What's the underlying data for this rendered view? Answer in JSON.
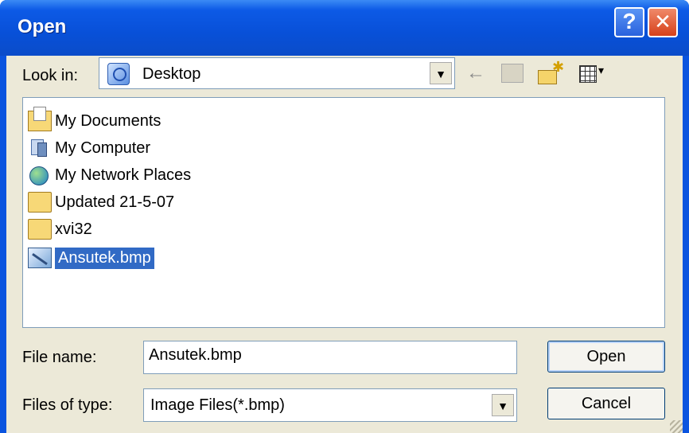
{
  "window": {
    "title": "Open"
  },
  "titlebar": {
    "help_glyph": "?",
    "close_glyph": "✕"
  },
  "look_in": {
    "label": "Look in:",
    "value": "Desktop",
    "dropdown_glyph": "▼"
  },
  "toolbar": {
    "back_glyph": "←",
    "views_arrow_glyph": "▾"
  },
  "files": [
    {
      "name": "My Documents",
      "icon": "my-documents-icon"
    },
    {
      "name": "My Computer",
      "icon": "my-computer-icon"
    },
    {
      "name": "My Network Places",
      "icon": "network-places-icon"
    },
    {
      "name": "Updated 21-5-07",
      "icon": "folder-icon"
    },
    {
      "name": "xvi32",
      "icon": "folder-icon"
    },
    {
      "name": "Ansutek.bmp",
      "icon": "bitmap-file-icon",
      "selected": true
    }
  ],
  "file_name": {
    "label": "File name:",
    "value": "Ansutek.bmp"
  },
  "file_type": {
    "label": "Files of type:",
    "value": "Image Files(*.bmp)",
    "dropdown_glyph": "▼"
  },
  "buttons": {
    "open": "Open",
    "cancel": "Cancel"
  },
  "colors": {
    "title_bar": "#0a54df",
    "selection": "#316ac5",
    "dialog_body": "#ece9d8"
  }
}
